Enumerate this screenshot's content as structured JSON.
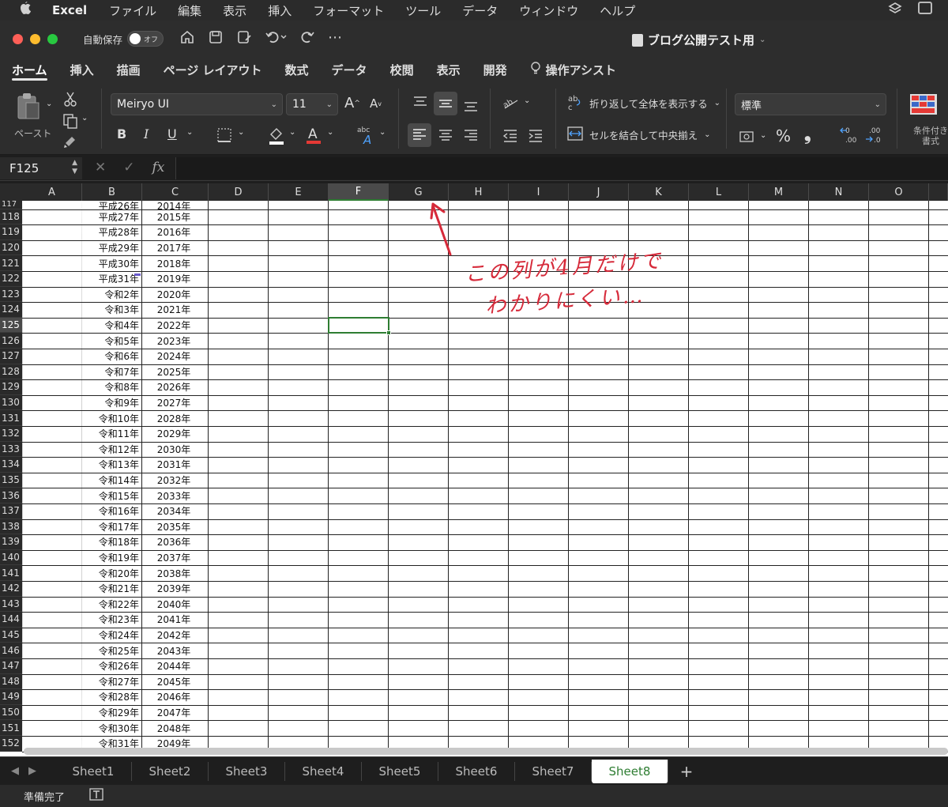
{
  "menubar": {
    "apple": "",
    "app": "Excel",
    "items": [
      "ファイル",
      "編集",
      "表示",
      "挿入",
      "フォーマット",
      "ツール",
      "データ",
      "ウィンドウ",
      "ヘルプ"
    ]
  },
  "titlebar": {
    "autosave_label": "自動保存",
    "autosave_state": "オフ",
    "doc_title": "ブログ公開テスト用"
  },
  "ribbon_tabs": [
    "ホーム",
    "挿入",
    "描画",
    "ページ レイアウト",
    "数式",
    "データ",
    "校閲",
    "表示",
    "開発",
    "操作アシスト"
  ],
  "ribbon": {
    "paste_label": "ペースト",
    "font_name": "Meiryo UI",
    "font_size": "11",
    "bold": "B",
    "italic": "I",
    "underline": "U",
    "wrap_text": "折り返して全体を表示する",
    "merge_center": "セルを結合して中央揃え",
    "number_format": "標準",
    "percent": "%",
    "comma": "❟",
    "conditional_format": "条件付き書式"
  },
  "formula_bar": {
    "name_box": "F125",
    "fx": "fx",
    "content": ""
  },
  "columns": [
    "A",
    "B",
    "C",
    "D",
    "E",
    "F",
    "G",
    "H",
    "I",
    "J",
    "K",
    "L",
    "M",
    "N",
    "O"
  ],
  "selected_cell": "F125",
  "rows": [
    {
      "n": "117",
      "b": "平成26年",
      "c": "2014年"
    },
    {
      "n": "118",
      "b": "平成27年",
      "c": "2015年"
    },
    {
      "n": "119",
      "b": "平成28年",
      "c": "2016年"
    },
    {
      "n": "120",
      "b": "平成29年",
      "c": "2017年"
    },
    {
      "n": "121",
      "b": "平成30年",
      "c": "2018年"
    },
    {
      "n": "122",
      "b": "平成31年",
      "c": "2019年"
    },
    {
      "n": "123",
      "b": "令和2年",
      "c": "2020年"
    },
    {
      "n": "124",
      "b": "令和3年",
      "c": "2021年"
    },
    {
      "n": "125",
      "b": "令和4年",
      "c": "2022年"
    },
    {
      "n": "126",
      "b": "令和5年",
      "c": "2023年"
    },
    {
      "n": "127",
      "b": "令和6年",
      "c": "2024年"
    },
    {
      "n": "128",
      "b": "令和7年",
      "c": "2025年"
    },
    {
      "n": "129",
      "b": "令和8年",
      "c": "2026年"
    },
    {
      "n": "130",
      "b": "令和9年",
      "c": "2027年"
    },
    {
      "n": "131",
      "b": "令和10年",
      "c": "2028年"
    },
    {
      "n": "132",
      "b": "令和11年",
      "c": "2029年"
    },
    {
      "n": "133",
      "b": "令和12年",
      "c": "2030年"
    },
    {
      "n": "134",
      "b": "令和13年",
      "c": "2031年"
    },
    {
      "n": "135",
      "b": "令和14年",
      "c": "2032年"
    },
    {
      "n": "136",
      "b": "令和15年",
      "c": "2033年"
    },
    {
      "n": "137",
      "b": "令和16年",
      "c": "2034年"
    },
    {
      "n": "138",
      "b": "令和17年",
      "c": "2035年"
    },
    {
      "n": "139",
      "b": "令和18年",
      "c": "2036年"
    },
    {
      "n": "140",
      "b": "令和19年",
      "c": "2037年"
    },
    {
      "n": "141",
      "b": "令和20年",
      "c": "2038年"
    },
    {
      "n": "142",
      "b": "令和21年",
      "c": "2039年"
    },
    {
      "n": "143",
      "b": "令和22年",
      "c": "2040年"
    },
    {
      "n": "144",
      "b": "令和23年",
      "c": "2041年"
    },
    {
      "n": "145",
      "b": "令和24年",
      "c": "2042年"
    },
    {
      "n": "146",
      "b": "令和25年",
      "c": "2043年"
    },
    {
      "n": "147",
      "b": "令和26年",
      "c": "2044年"
    },
    {
      "n": "148",
      "b": "令和27年",
      "c": "2045年"
    },
    {
      "n": "149",
      "b": "令和28年",
      "c": "2046年"
    },
    {
      "n": "150",
      "b": "令和29年",
      "c": "2047年"
    },
    {
      "n": "151",
      "b": "令和30年",
      "c": "2048年"
    },
    {
      "n": "152",
      "b": "令和31年",
      "c": "2049年"
    }
  ],
  "annotation": {
    "line1": "この列が4月だけで",
    "line2": "わかりにくい…"
  },
  "sheets": [
    "Sheet1",
    "Sheet2",
    "Sheet3",
    "Sheet4",
    "Sheet5",
    "Sheet6",
    "Sheet7",
    "Sheet8"
  ],
  "active_sheet": "Sheet8",
  "status": "準備完了",
  "colors": {
    "selection": "#2e7d32",
    "annotation": "#d62a3a"
  }
}
